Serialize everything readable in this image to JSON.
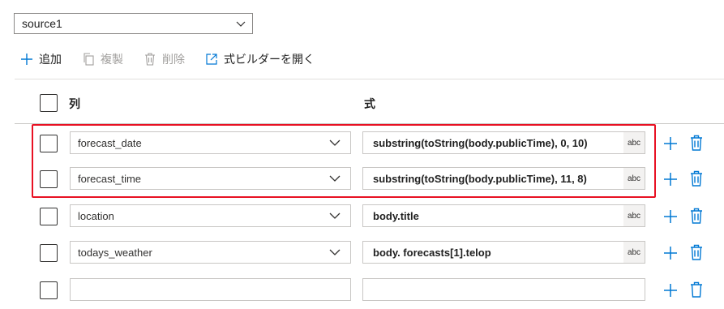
{
  "source": {
    "selected": "source1"
  },
  "toolbar": {
    "add_label": "追加",
    "copy_label": "複製",
    "delete_label": "削除",
    "builder_label": "式ビルダーを開く"
  },
  "table": {
    "col_header": "列",
    "expr_header": "式"
  },
  "rows": [
    {
      "column": "forecast_date",
      "expression": "substring(toString(body.publicTime), 0, 10)",
      "type": "abc"
    },
    {
      "column": "forecast_time",
      "expression": "substring(toString(body.publicTime), 11, 8)",
      "type": "abc"
    },
    {
      "column": "location",
      "expression": "body.title",
      "type": "abc"
    },
    {
      "column": "todays_weather",
      "expression": "body. forecasts[1].telop",
      "type": "abc"
    },
    {
      "column": "",
      "expression": "",
      "type": ""
    }
  ],
  "colors": {
    "accent": "#0078d4",
    "highlight": "#e81123",
    "disabled": "#a19f9d"
  },
  "icons": {
    "add": "plus-icon",
    "copy": "copy-icon",
    "delete": "trash-icon",
    "builder": "open-external-icon",
    "dropdown": "chevron-down-icon"
  }
}
